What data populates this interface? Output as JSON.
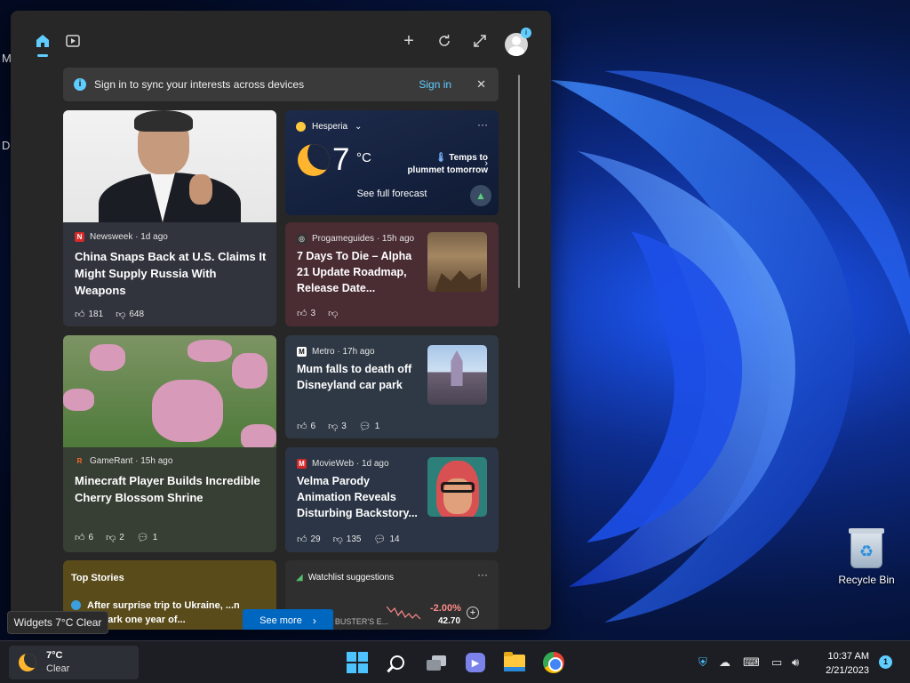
{
  "desktop": {
    "letters": [
      "M",
      "D"
    ],
    "recycle_bin_label": "Recycle Bin"
  },
  "widgets": {
    "tabs": [
      {
        "name": "home-icon",
        "active": true
      },
      {
        "name": "video-icon",
        "active": false
      }
    ],
    "toolbar_icons": [
      "add-icon",
      "refresh-icon",
      "expand-icon"
    ],
    "avatar_badge": "i",
    "signin_bar": {
      "message": "Sign in to sync your interests across devices",
      "link": "Sign in"
    },
    "cards": {
      "newsweek": {
        "source": "Newsweek · 1d ago",
        "title": "China Snaps Back at U.S. Claims It Might Supply Russia With Weapons",
        "likes": "181",
        "dislikes": "648"
      },
      "weather": {
        "location": "Hesperia",
        "temp": "7",
        "unit": "°C",
        "alert": "Temps to plummet tomorrow",
        "forecast": "See full forecast"
      },
      "progameguides": {
        "source": "Progameguides · 15h ago",
        "title": "7 Days To Die – Alpha 21 Update Roadmap, Release Date...",
        "likes": "3"
      },
      "metro": {
        "source": "Metro · 17h ago",
        "title": "Mum falls to death off Disneyland car park",
        "likes": "6",
        "dislikes": "3",
        "comments": "1"
      },
      "gamerant": {
        "source": "GameRant · 15h ago",
        "title": "Minecraft Player Builds Incredible Cherry Blossom Shrine",
        "likes": "6",
        "dislikes": "2",
        "comments": "1"
      },
      "movieweb": {
        "source": "MovieWeb · 1d ago",
        "title": "Velma Parody Animation Reveals Disturbing Backstory...",
        "likes": "29",
        "dislikes": "135",
        "comments": "14"
      },
      "top_stories": {
        "heading": "Top Stories",
        "item": "After surprise trip to Ukraine, ...n to mark one year of..."
      },
      "watchlist": {
        "heading": "Watchlist suggestions",
        "ticker": "DAVE & BUSTER'S E...",
        "ticker_prefix": "...y",
        "change": "-2.00%",
        "price": "42.70"
      }
    },
    "see_more": "See more"
  },
  "tooltip": "Widgets 7°C Clear",
  "taskbar": {
    "weather_temp": "7°C",
    "weather_cond": "Clear",
    "apps": [
      "start-button",
      "search-button",
      "task-view-button",
      "chat-button",
      "file-explorer-button",
      "chrome-button"
    ],
    "time": "10:37 AM",
    "date": "2/21/2023",
    "notifications": "1"
  }
}
